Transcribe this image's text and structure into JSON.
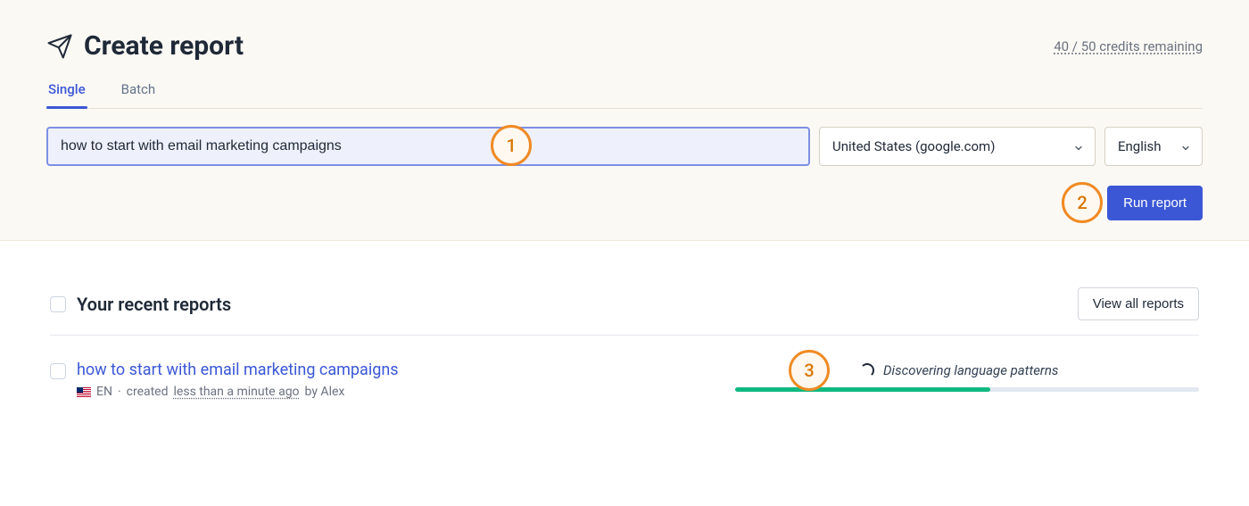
{
  "header": {
    "title": "Create report",
    "credits_text": "40 / 50 credits remaining"
  },
  "tabs": {
    "single": "Single",
    "batch": "Batch"
  },
  "form": {
    "topic_value": "how to start with email marketing campaigns",
    "region_selected": "United States (google.com)",
    "language_selected": "English",
    "run_label": "Run report"
  },
  "callouts": {
    "one": "1",
    "two": "2",
    "three": "3"
  },
  "recent": {
    "title": "Your recent reports",
    "view_all": "View all reports",
    "items": [
      {
        "title": "how to start with email marketing campaigns",
        "lang_code": "EN",
        "meta_sep": " · ",
        "meta_prefix": "created ",
        "time_ago": "less than a minute ago",
        "meta_suffix": " by Alex",
        "status_text": "Discovering language patterns",
        "progress_pct": 55
      }
    ]
  }
}
